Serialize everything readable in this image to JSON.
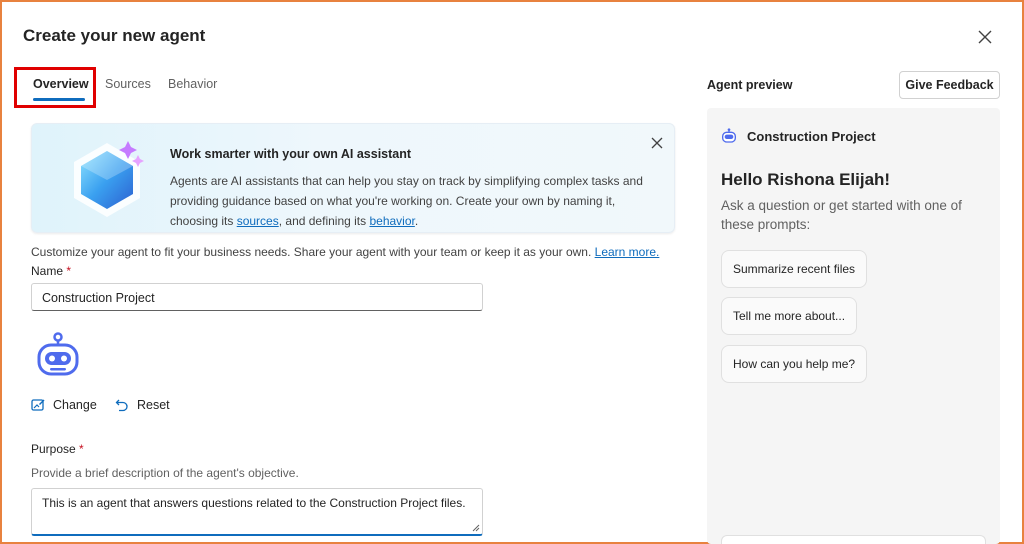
{
  "dialog": {
    "title": "Create your new agent"
  },
  "tabs": [
    {
      "label": "Overview",
      "active": true
    },
    {
      "label": "Sources",
      "active": false
    },
    {
      "label": "Behavior",
      "active": false
    }
  ],
  "banner": {
    "title": "Work smarter with your own AI assistant",
    "body_start": "Agents are AI assistants that can help you stay on track by simplifying complex tasks and providing guidance based on what you're working on. Create your own by naming it, choosing its ",
    "sources_link": "sources",
    "body_middle": ", and defining its ",
    "behavior_link": "behavior",
    "body_end": "."
  },
  "intro": {
    "text": "Customize your agent to fit your business needs. Share your agent with your team or keep it as your own.",
    "learn_more": "Learn more."
  },
  "name_field": {
    "label": "Name",
    "required_mark": "*",
    "value": "Construction Project"
  },
  "icon_actions": {
    "change_label": "Change",
    "reset_label": "Reset"
  },
  "purpose_field": {
    "label": "Purpose",
    "required_mark": "*",
    "hint": "Provide a brief description of the agent's objective.",
    "value": "This is an agent that answers questions related to the Construction Project files."
  },
  "preview": {
    "title": "Agent preview",
    "feedback_label": "Give Feedback",
    "agent_name": "Construction Project",
    "greeting": "Hello Rishona Elijah!",
    "subtitle": "Ask a question or get started with one of these prompts:",
    "prompts": [
      "Summarize recent files",
      "Tell me more about...",
      "How can you help me?"
    ]
  },
  "colors": {
    "accent": "#0f6cbd",
    "highlight_border": "#e00000",
    "frame_border": "#e8823f",
    "required": "#c50f1f"
  }
}
